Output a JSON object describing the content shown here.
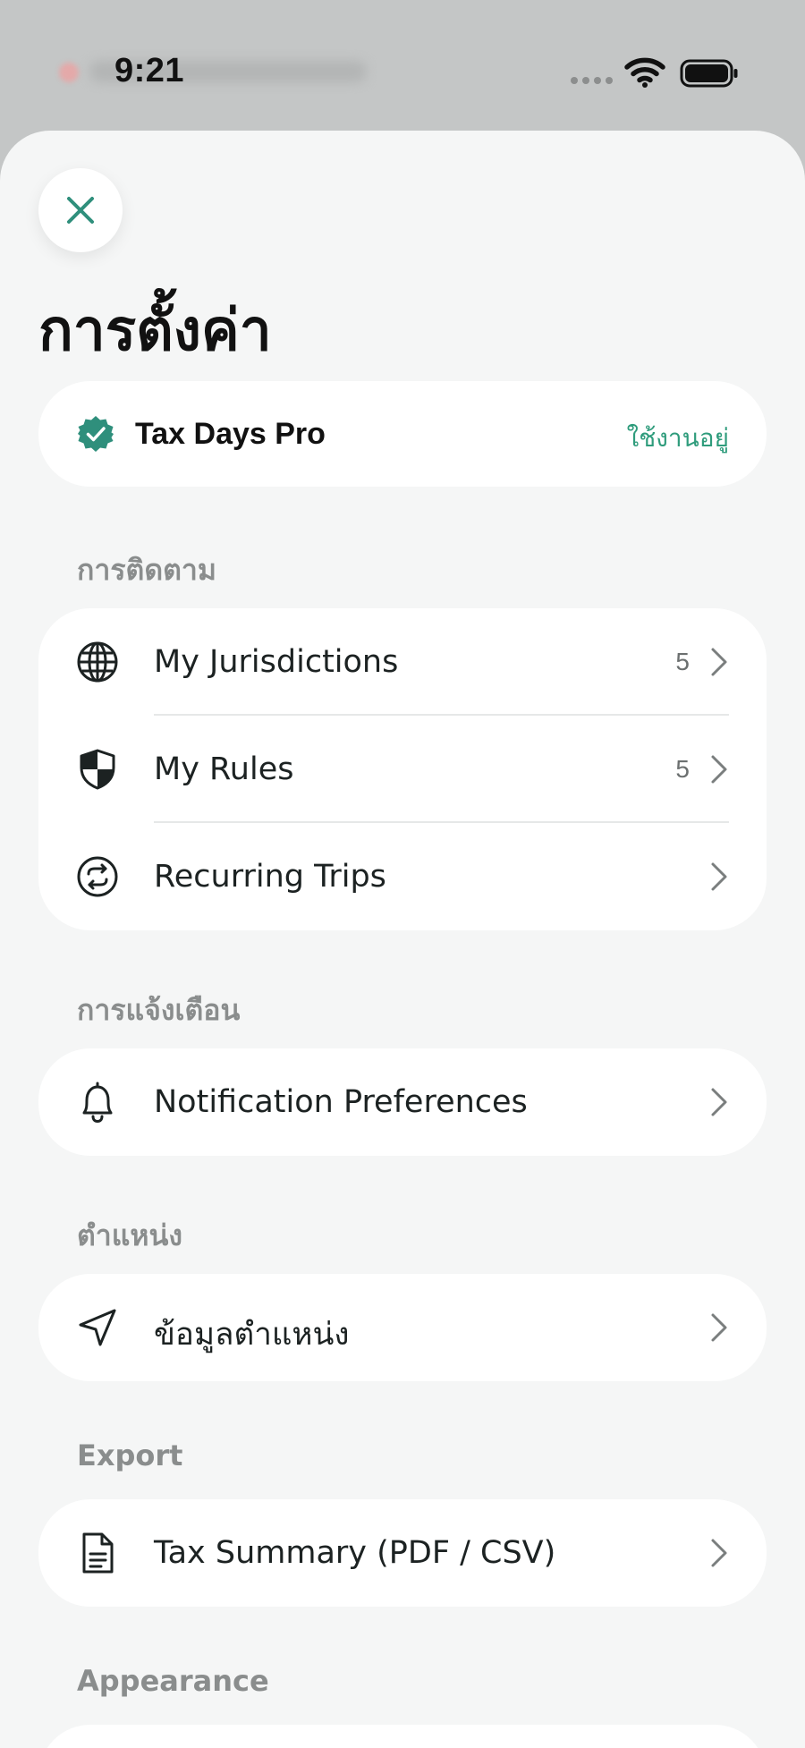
{
  "status_bar": {
    "time": "9:21"
  },
  "title": "การตั้งค่า",
  "pro": {
    "name": "Tax Days Pro",
    "status": "ใช้งานอยู่"
  },
  "sections": {
    "tracking": {
      "label": "การติดตาม",
      "items": [
        {
          "label": "My Jurisdictions",
          "count": "5",
          "icon": "globe-icon"
        },
        {
          "label": "My Rules",
          "count": "5",
          "icon": "shield-icon"
        },
        {
          "label": "Recurring Trips",
          "icon": "repeat-icon"
        }
      ]
    },
    "notifications": {
      "label": "การแจ้งเตือน",
      "items": [
        {
          "label": "Notification Preferences",
          "icon": "bell-icon"
        }
      ]
    },
    "location": {
      "label": "ตำแหน่ง",
      "items": [
        {
          "label": "ข้อมูลตำแหน่ง",
          "icon": "navigation-arrow-icon"
        }
      ]
    },
    "export": {
      "label": "Export",
      "items": [
        {
          "label": "Tax Summary (PDF / CSV)",
          "icon": "document-icon"
        }
      ]
    },
    "appearance": {
      "label": "Appearance"
    }
  },
  "colors": {
    "accent": "#2f8f7c",
    "sheet_background": "#f5f6f6",
    "card_background": "#ffffff",
    "muted_text": "#8a8d8d"
  }
}
